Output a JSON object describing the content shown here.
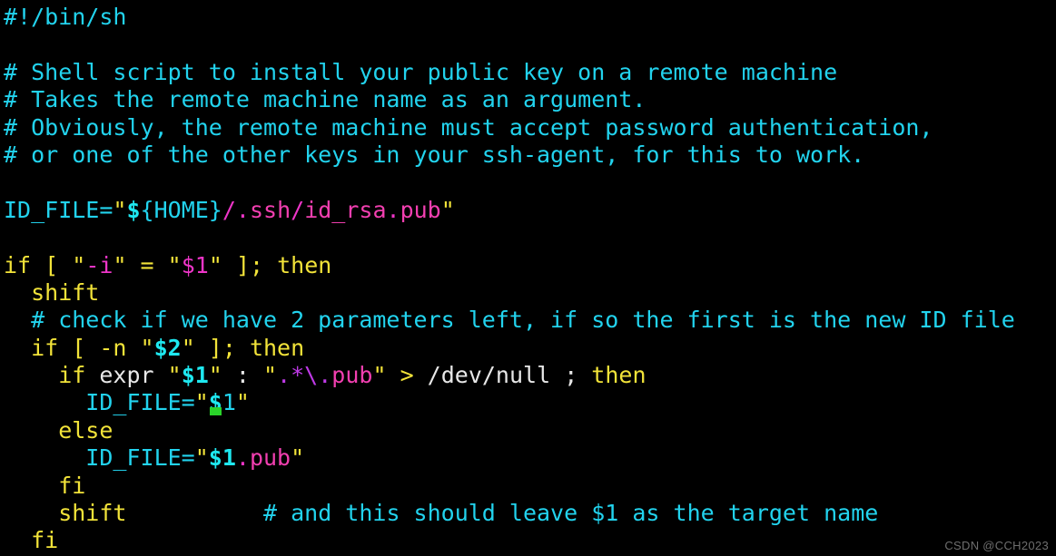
{
  "terminal": {
    "background": "#000000",
    "font_size_px": 25,
    "line_height_px": 30.4,
    "colors": {
      "comment": "#22d3ee",
      "cyan": "#22d3ee",
      "cyan_bold": "#1ee8f0",
      "keyword": "#f2e339",
      "quote": "#f2e339",
      "magenta": "#ee35c8",
      "pink": "#f23fb0",
      "purple": "#c03ae8",
      "plain": "#e8e8e8",
      "cursor": "#2ad52a"
    }
  },
  "code": {
    "lines": [
      {
        "id": "line-1-shebang",
        "tokens": [
          {
            "text": "#!/bin/sh",
            "color": "comment"
          }
        ]
      },
      {
        "id": "line-2-blank",
        "tokens": []
      },
      {
        "id": "line-3-comment-shell-script",
        "tokens": [
          {
            "text": "# Shell script to install your public key on a remote machine",
            "color": "comment"
          }
        ]
      },
      {
        "id": "line-4-comment-takes-remote",
        "tokens": [
          {
            "text": "# Takes the remote machine name as an argument.",
            "color": "comment"
          }
        ]
      },
      {
        "id": "line-5-comment-obviously",
        "tokens": [
          {
            "text": "# Obviously, the remote machine must accept password authentication,",
            "color": "comment"
          }
        ]
      },
      {
        "id": "line-6-comment-or-one-of",
        "tokens": [
          {
            "text": "# or one of the other keys in your ssh-agent, for this to work.",
            "color": "comment"
          }
        ]
      },
      {
        "id": "line-7-blank",
        "tokens": []
      },
      {
        "id": "line-8-id-file-assign",
        "tokens": [
          {
            "text": "ID_FILE=",
            "color": "cyan"
          },
          {
            "text": "\"",
            "color": "quote"
          },
          {
            "text": "$",
            "color": "cyan_bold"
          },
          {
            "text": "{HOME}",
            "color": "cyan"
          },
          {
            "text": "/.",
            "color": "magenta"
          },
          {
            "text": "ssh",
            "color": "pink"
          },
          {
            "text": "/",
            "color": "magenta"
          },
          {
            "text": "id_rsa",
            "color": "pink"
          },
          {
            "text": ".",
            "color": "magenta"
          },
          {
            "text": "pub",
            "color": "pink"
          },
          {
            "text": "\"",
            "color": "quote"
          }
        ]
      },
      {
        "id": "line-9-blank",
        "tokens": []
      },
      {
        "id": "line-10-if-dash-i",
        "tokens": [
          {
            "text": "if [ ",
            "color": "keyword"
          },
          {
            "text": "\"",
            "color": "quote"
          },
          {
            "text": "-i",
            "color": "magenta"
          },
          {
            "text": "\"",
            "color": "quote"
          },
          {
            "text": " = ",
            "color": "keyword"
          },
          {
            "text": "\"",
            "color": "quote"
          },
          {
            "text": "$1",
            "color": "magenta"
          },
          {
            "text": "\"",
            "color": "quote"
          },
          {
            "text": " ]; then",
            "color": "keyword"
          }
        ]
      },
      {
        "id": "line-11-shift",
        "tokens": [
          {
            "text": "  shift",
            "color": "keyword"
          }
        ]
      },
      {
        "id": "line-12-comment-check-params",
        "tokens": [
          {
            "text": "  # check if we have 2 parameters left, if so the first is the new ID file",
            "color": "comment"
          }
        ]
      },
      {
        "id": "line-13-if-dash-n",
        "tokens": [
          {
            "text": "  if [ -n ",
            "color": "keyword"
          },
          {
            "text": "\"",
            "color": "quote"
          },
          {
            "text": "$2",
            "color": "cyan_bold"
          },
          {
            "text": "\"",
            "color": "quote"
          },
          {
            "text": " ]; then",
            "color": "keyword"
          }
        ]
      },
      {
        "id": "line-14-if-expr",
        "tokens": [
          {
            "text": "    if ",
            "color": "keyword"
          },
          {
            "text": "expr ",
            "color": "plain"
          },
          {
            "text": "\"",
            "color": "quote"
          },
          {
            "text": "$1",
            "color": "cyan_bold"
          },
          {
            "text": "\"",
            "color": "quote"
          },
          {
            "text": " : ",
            "color": "plain"
          },
          {
            "text": "\"",
            "color": "quote"
          },
          {
            "text": ".*\\.",
            "color": "purple"
          },
          {
            "text": "pub",
            "color": "pink"
          },
          {
            "text": "\"",
            "color": "quote"
          },
          {
            "text": " > ",
            "color": "yellow"
          },
          {
            "text": "/dev/null ",
            "color": "plain"
          },
          {
            "text": "; ",
            "color": "plain"
          },
          {
            "text": "then",
            "color": "keyword"
          }
        ]
      },
      {
        "id": "line-15-id-file-dollar1",
        "cursor_after_token": 3,
        "tokens": [
          {
            "text": "      ID_FILE=",
            "color": "cyan"
          },
          {
            "text": "\"",
            "color": "quote"
          },
          {
            "text": "$",
            "color": "cyan_bold",
            "cursor": true
          },
          {
            "text": "1",
            "color": "cyan"
          },
          {
            "text": "\"",
            "color": "quote"
          }
        ]
      },
      {
        "id": "line-16-else",
        "tokens": [
          {
            "text": "    else",
            "color": "keyword"
          }
        ]
      },
      {
        "id": "line-17-id-file-dollar1-pub",
        "tokens": [
          {
            "text": "      ID_FILE=",
            "color": "cyan"
          },
          {
            "text": "\"",
            "color": "quote"
          },
          {
            "text": "$1",
            "color": "cyan_bold"
          },
          {
            "text": ".",
            "color": "magenta"
          },
          {
            "text": "pub",
            "color": "pink"
          },
          {
            "text": "\"",
            "color": "quote"
          }
        ]
      },
      {
        "id": "line-18-fi-inner",
        "tokens": [
          {
            "text": "    fi",
            "color": "keyword"
          }
        ]
      },
      {
        "id": "line-19-shift-with-comment",
        "tokens": [
          {
            "text": "    shift",
            "color": "keyword"
          },
          {
            "text": "          ",
            "color": "plain"
          },
          {
            "text": "# and this should leave $1 as the target name",
            "color": "comment"
          }
        ]
      },
      {
        "id": "line-20-fi-outer",
        "tokens": [
          {
            "text": "  fi",
            "color": "keyword"
          }
        ]
      }
    ]
  },
  "watermark": {
    "text": "CSDN @CCH2023"
  }
}
